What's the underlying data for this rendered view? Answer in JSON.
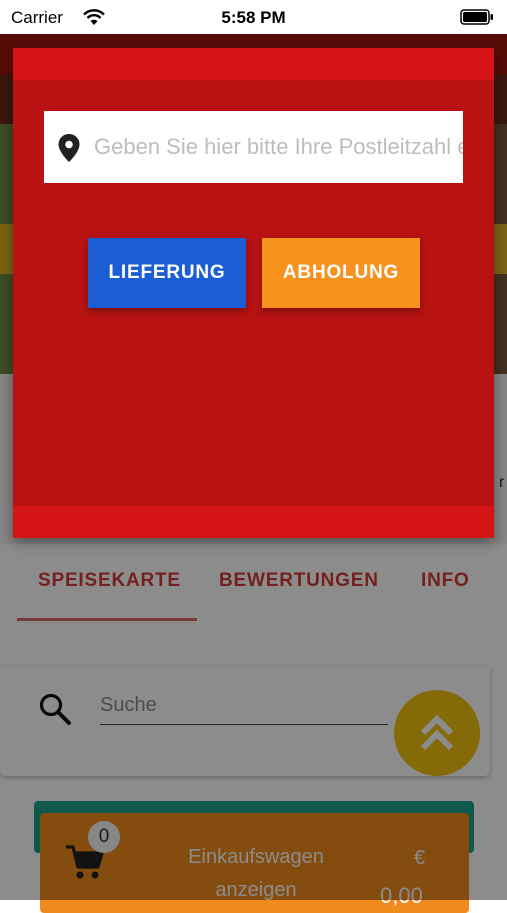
{
  "status_bar": {
    "carrier": "Carrier",
    "time": "5:58 PM"
  },
  "modal": {
    "zip_placeholder": "Geben Sie hier bitte Ihre Postleitzahl ein",
    "delivery_label": "LIEFERUNG",
    "pickup_label": "ABHOLUNG",
    "colors": {
      "background": "#b81212",
      "delivery": "#1a5dd4",
      "pickup": "#f7921e"
    }
  },
  "tabs": [
    {
      "label": "SPEISEKARTE",
      "active": true
    },
    {
      "label": "BEWERTUNGEN",
      "active": false
    },
    {
      "label": "INFO",
      "active": false
    }
  ],
  "search": {
    "placeholder": "Suche"
  },
  "cart": {
    "count": "0",
    "label": "Einkaufswagen anzeigen",
    "currency": "€",
    "total": "0,00"
  },
  "background_peek_text": "r",
  "icons": [
    "wifi-icon",
    "battery-icon",
    "map-pin-icon",
    "search-icon",
    "double-chevron-up-icon",
    "cart-icon"
  ]
}
